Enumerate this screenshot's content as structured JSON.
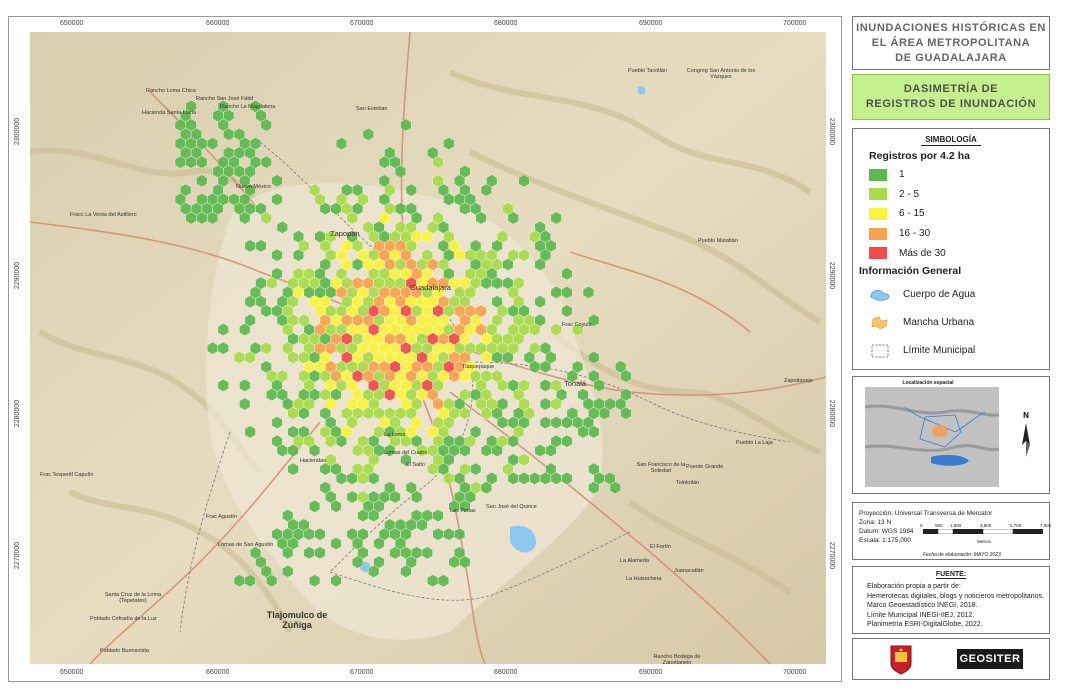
{
  "title": {
    "lines": [
      "INUNDACIONES HISTÓRICAS EN",
      "EL ÁREA METROPOLITANA",
      "DE GUADALAJARA"
    ]
  },
  "subtitle": {
    "lines": [
      "DASIMETRÍA DE",
      "REGISTROS DE INUNDACIÓN"
    ]
  },
  "legend": {
    "heading": "SIMBOLOGÍA",
    "registros_title": "Registros por 4.2 ha",
    "classes": [
      {
        "label": "1",
        "color": "#5cb94e"
      },
      {
        "label": "2 - 5",
        "color": "#a8dc4a"
      },
      {
        "label": "6 - 15",
        "color": "#fbf33d"
      },
      {
        "label": "16 - 30",
        "color": "#f8a24b"
      },
      {
        "label": "Más de 30",
        "color": "#f24b4b"
      }
    ],
    "info_title": "Información General",
    "info_items": [
      {
        "label": "Cuerpo de Agua",
        "icon": "water-body-icon",
        "color": "#8fc8ee"
      },
      {
        "label": "Mancha Urbana",
        "icon": "urban-area-icon",
        "color": "#f7c86a"
      },
      {
        "label": "Límite Municipal",
        "icon": "municipal-boundary-icon",
        "color": "#555555"
      }
    ]
  },
  "location": {
    "title": "Localización espacial"
  },
  "projection": {
    "lines": [
      "Proyección: Universal Transversa de Mercator",
      "Zona: 13 N",
      "Datum: WGS 1984",
      "Escala: 1:175,000"
    ],
    "scale_ticks": [
      "0",
      "950",
      "1,900",
      "3,800",
      "5,700",
      "7,600"
    ],
    "scale_units": "Metros",
    "date": "Fecha de elaboración: MAYO 2023"
  },
  "source": {
    "heading": "FUENTE:",
    "lines": [
      "Elaboración propia a partir de:",
      "Hemerotecas digitales, blogs y noticieros metropolitanos.",
      "Marco Geoestadístico INEGI, 2018.",
      "Límite Municipal INEGI-IIEJ, 2012.",
      "Planimetría ESRI-DigitalGlobe, 2022."
    ]
  },
  "logos": {
    "geositer": "GEOSITER"
  },
  "grid": {
    "x_labels": [
      "650000",
      "660000",
      "670000",
      "680000",
      "690000",
      "700000"
    ],
    "y_labels": [
      "2300000",
      "2290000",
      "2280000",
      "2270000"
    ]
  },
  "places": [
    {
      "name": "Zapopan",
      "size": "mid"
    },
    {
      "name": "Guadalajara",
      "size": "mid"
    },
    {
      "name": "Tlaquepaque",
      "size": "small"
    },
    {
      "name": "Tonalá",
      "size": "mid"
    },
    {
      "name": "El Salto",
      "size": "small"
    },
    {
      "name": "Tlajomulco de Zúñiga",
      "size": "big"
    },
    {
      "name": "Pueblo Tacotlán",
      "size": "small"
    },
    {
      "name": "Congreg San Antonio de los Vázquez",
      "size": "small"
    },
    {
      "name": "San Esteban",
      "size": "small"
    },
    {
      "name": "Nuevo México",
      "size": "small"
    },
    {
      "name": "Fracc La Venta del Astillero",
      "size": "small"
    },
    {
      "name": "Pueblo Matatlán",
      "size": "small"
    },
    {
      "name": "Frac Coyula",
      "size": "small"
    },
    {
      "name": "Zapotlanejo",
      "size": "small"
    },
    {
      "name": "Pueblo La Laja",
      "size": "small"
    },
    {
      "name": "San Francisco de la Soledad",
      "size": "small"
    },
    {
      "name": "Puente Grande",
      "size": "small"
    },
    {
      "name": "Tololotlán",
      "size": "small"
    },
    {
      "name": "Juanacatlán",
      "size": "small"
    },
    {
      "name": "La Alameda",
      "size": "small"
    },
    {
      "name": "El Fortín",
      "size": "small"
    },
    {
      "name": "San José del Quince",
      "size": "small"
    },
    {
      "name": "Lomas de San Agustín",
      "size": "small"
    },
    {
      "name": "Frac Agustín",
      "size": "small"
    },
    {
      "name": "Santa Cruz de la Loma (Tepetates)",
      "size": "small"
    },
    {
      "name": "Poblado Cofradía de la Luz",
      "size": "small"
    },
    {
      "name": "Poblado Buenavista",
      "size": "small"
    },
    {
      "name": "Frac Tesperitl Capulín",
      "size": "small"
    },
    {
      "name": "Rancho Loma Chica",
      "size": "small"
    },
    {
      "name": "Rancho San José Fátid",
      "size": "small"
    },
    {
      "name": "Rancho La Magdalena",
      "size": "small"
    },
    {
      "name": "Hacienda Santa Lucía",
      "size": "small"
    },
    {
      "name": "La Loma",
      "size": "small"
    },
    {
      "name": "Lomas del Cuatro",
      "size": "small"
    },
    {
      "name": "Haciendas",
      "size": "small"
    },
    {
      "name": "Las Pintas",
      "size": "small"
    },
    {
      "name": "La Huizachera",
      "size": "small"
    },
    {
      "name": "Rancho Bodega de Zapotlanejo",
      "size": "small"
    }
  ]
}
